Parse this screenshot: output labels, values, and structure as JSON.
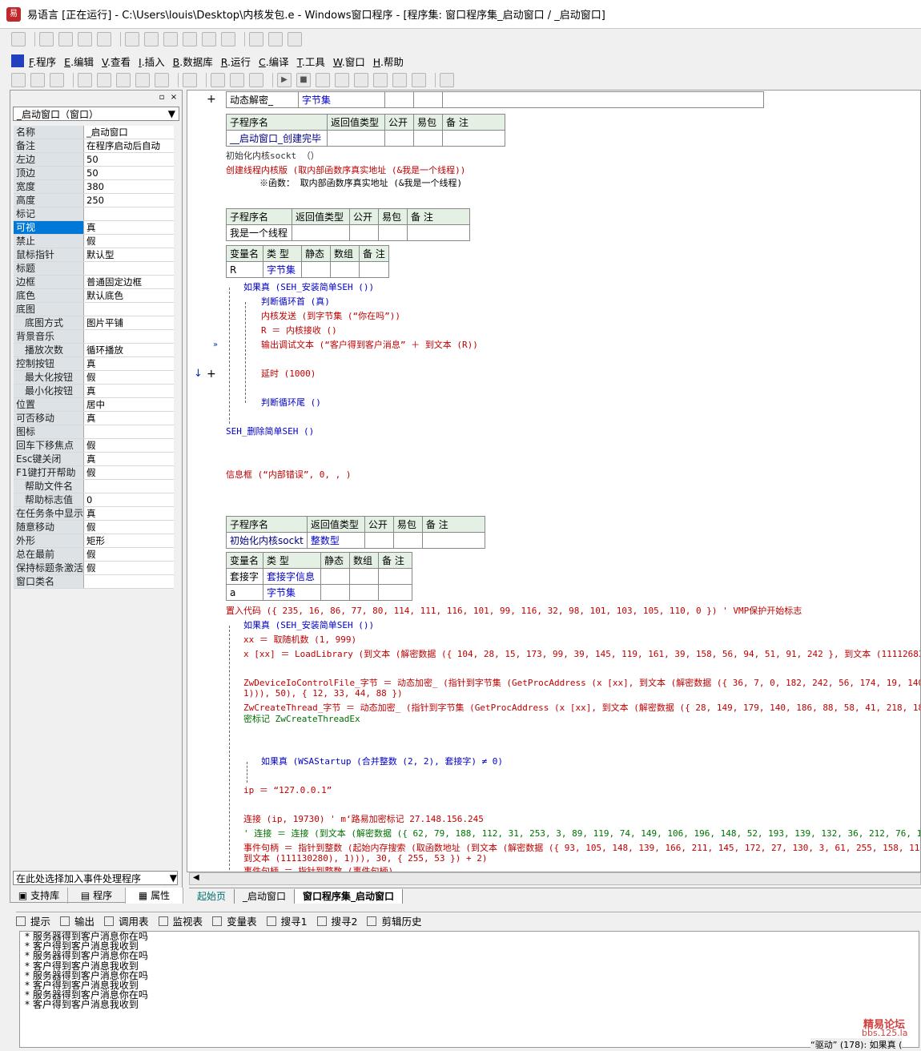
{
  "window": {
    "title": "易语言 [正在运行] - C:\\Users\\louis\\Desktop\\内核发包.e - Windows窗口程序 - [程序集: 窗口程序集_启动窗口 / _启动窗口]"
  },
  "menu": [
    {
      "key": "F",
      "label": ".程序"
    },
    {
      "key": "E",
      "label": ".编辑"
    },
    {
      "key": "V",
      "label": ".查看"
    },
    {
      "key": "I",
      "label": ".插入"
    },
    {
      "key": "B",
      "label": ".数据库"
    },
    {
      "key": "R",
      "label": ".运行"
    },
    {
      "key": "C",
      "label": ".编译"
    },
    {
      "key": "T",
      "label": ".工具"
    },
    {
      "key": "W",
      "label": ".窗口"
    },
    {
      "key": "H",
      "label": ".帮助"
    }
  ],
  "left_panel": {
    "selector": "_启动窗口（窗口）",
    "properties": [
      {
        "name": "名称",
        "value": "_启动窗口"
      },
      {
        "name": "备注",
        "value": "在程序启动后自动"
      },
      {
        "name": "左边",
        "value": "50"
      },
      {
        "name": "顶边",
        "value": "50"
      },
      {
        "name": "宽度",
        "value": "380"
      },
      {
        "name": "高度",
        "value": "250"
      },
      {
        "name": "标记",
        "value": ""
      },
      {
        "name": "可视",
        "value": "真",
        "selected": true
      },
      {
        "name": "禁止",
        "value": "假"
      },
      {
        "name": "鼠标指针",
        "value": "默认型"
      },
      {
        "name": "标题",
        "value": ""
      },
      {
        "name": "边框",
        "value": "普通固定边框"
      },
      {
        "name": "底色",
        "value": "默认底色"
      },
      {
        "name": "底图",
        "value": ""
      },
      {
        "name": "底图方式",
        "value": "图片平铺",
        "indent": true
      },
      {
        "name": "背景音乐",
        "value": ""
      },
      {
        "name": "播放次数",
        "value": "循环播放",
        "indent": true
      },
      {
        "name": "控制按钮",
        "value": "真"
      },
      {
        "name": "最大化按钮",
        "value": "假",
        "indent": true
      },
      {
        "name": "最小化按钮",
        "value": "真",
        "indent": true
      },
      {
        "name": "位置",
        "value": "居中"
      },
      {
        "name": "可否移动",
        "value": "真"
      },
      {
        "name": "图标",
        "value": ""
      },
      {
        "name": "回车下移焦点",
        "value": "假"
      },
      {
        "name": "Esc键关闭",
        "value": "真"
      },
      {
        "name": "F1键打开帮助",
        "value": "假"
      },
      {
        "name": "帮助文件名",
        "value": "",
        "indent": true
      },
      {
        "name": "帮助标志值",
        "value": "0",
        "indent": true
      },
      {
        "name": "在任务条中显示",
        "value": "真"
      },
      {
        "name": "随意移动",
        "value": "假"
      },
      {
        "name": "外形",
        "value": "矩形"
      },
      {
        "name": "总在最前",
        "value": "假"
      },
      {
        "name": "保持标题条激活",
        "value": "假"
      },
      {
        "name": "窗口类名",
        "value": ""
      }
    ],
    "event_selector": "在此处选择加入事件处理程序",
    "tabs": [
      "支持库",
      "程序",
      "属性"
    ]
  },
  "editor": {
    "top_table": {
      "c1": "动态解密_",
      "c2": "字节集"
    },
    "sub1": {
      "headers": [
        "子程序名",
        "返回值类型",
        "公开",
        "易包",
        "备 注"
      ],
      "row": "__启动窗口_创建完毕"
    },
    "sub1_lines": [
      "初始化内核sockt （）",
      "创建线程内核版 (取内部函数序真实地址 (&我是一个线程))",
      "※函数： 取内部函数序真实地址 (&我是一个线程)"
    ],
    "sub2": {
      "headers": [
        "子程序名",
        "返回值类型",
        "公开",
        "易包",
        "备 注"
      ],
      "row": "我是一个线程"
    },
    "var1": {
      "headers": [
        "变量名",
        "类 型",
        "静态",
        "数组",
        "备 注"
      ],
      "rows": [
        [
          "R",
          "字节集"
        ]
      ]
    },
    "sub2_lines": [
      "如果真 (SEH_安装简单SEH ())",
      "判断循环首 (真)",
      "内核发送 (到字节集 (“你在吗”))",
      "R ＝ 内核接收 ()",
      "输出调试文本 (“客户得到客户消息” ＋ 到文本 (R))",
      "延时 (1000)",
      "判断循环尾 ()",
      "SEH_删除简单SEH ()",
      "信息框 (“内部错误”, 0, , )"
    ],
    "sub3": {
      "headers": [
        "子程序名",
        "返回值类型",
        "公开",
        "易包",
        "备 注"
      ],
      "row": [
        "初始化内核sockt",
        "整数型"
      ]
    },
    "var2": {
      "headers": [
        "变量名",
        "类 型",
        "静态",
        "数组",
        "备 注"
      ],
      "rows": [
        [
          "套接字",
          "套接字信息"
        ],
        [
          "a",
          "字节集"
        ]
      ]
    },
    "sub3_lines": [
      "置入代码 ({ 235, 16, 86, 77, 80, 114, 111, 116, 101, 99, 116, 32, 98, 101, 103, 105, 110, 0 })  ' VMP保护开始标志",
      "如果真 (SEH_安装简单SEH ())",
      "xx ＝ 取随机数 (1, 999)",
      "x [xx] ＝ LoadLibrary (到文本 (解密数据 ({ 104, 28, 15, 173, 99, 39, 145, 119, 161, 39, 158, 56, 94, 51, 91, 242 }, 到文本 (111126835), 1)))",
      "ZwDeviceIoControlFile_字节 ＝ 动态加密_ (指针到字节集 (GetProcAddress (x [xx], 到文本 (解密数据 ({ 36, 7, 0, 182, 242, 56, 174, 19, 140, 254,",
      "1))), 50), { 12, 33, 44, 88 })",
      "ZwCreateThread_字节 ＝ 动态加密_ (指针到字节集 (GetProcAddress (x [xx], 到文本 (解密数据 ({ 28, 149, 179, 140, 186, 88, 58, 41, 218, 189, 7,",
      "密标记  ZwCreateThreadEx",
      "如果真 (WSAStartup (合并整数 (2, 2), 套接字) ≠ 0)",
      "ip ＝ “127.0.0.1”",
      "连接 (ip, 19730)  ' m‘路易加密标记  27.148.156.245",
      "' 连接 ＝ 连接 (到文本 (解密数据 ({ 62, 79, 188, 112, 31, 253, 3, 89, 119, 74, 149, 106, 196, 148, 52, 193, 139, 132, 36, 212, 76, 128, 45, 1",
      "事件句柄 ＝ 指针到整数 (起始内存搜索 (取函数地址 (到文本 (解密数据 ({ 93, 105, 148, 139, 166, 211, 145, 172, 27, 130, 3, 61, 255, 158, 11, 13",
      "到文本 (111130280), 1))), 30, { 255, 53 }) + 2)",
      "事件句柄 ＝ 指针到整数 (事件句柄)"
    ]
  },
  "editor_tabs": [
    "起始页",
    "_启动窗口",
    "窗口程序集_启动窗口"
  ],
  "bottom_tabs": [
    "提示",
    "输出",
    "调用表",
    "监视表",
    "变量表",
    "搜寻1",
    "搜寻2",
    "剪辑历史"
  ],
  "output": [
    "* 服务器得到客户消息你在吗",
    "* 客户得到客户消息我收到",
    "* 服务器得到客户消息你在吗",
    "* 客户得到客户消息我收到",
    "* 服务器得到客户消息你在吗",
    "* 客户得到客户消息我收到",
    "* 服务器得到客户消息你在吗",
    "* 客户得到客户消息我收到"
  ],
  "watermark": {
    "line1": "精易论坛",
    "line2": "bbs.125.la"
  },
  "status_text": "“驱动” (178): 如果真 ("
}
